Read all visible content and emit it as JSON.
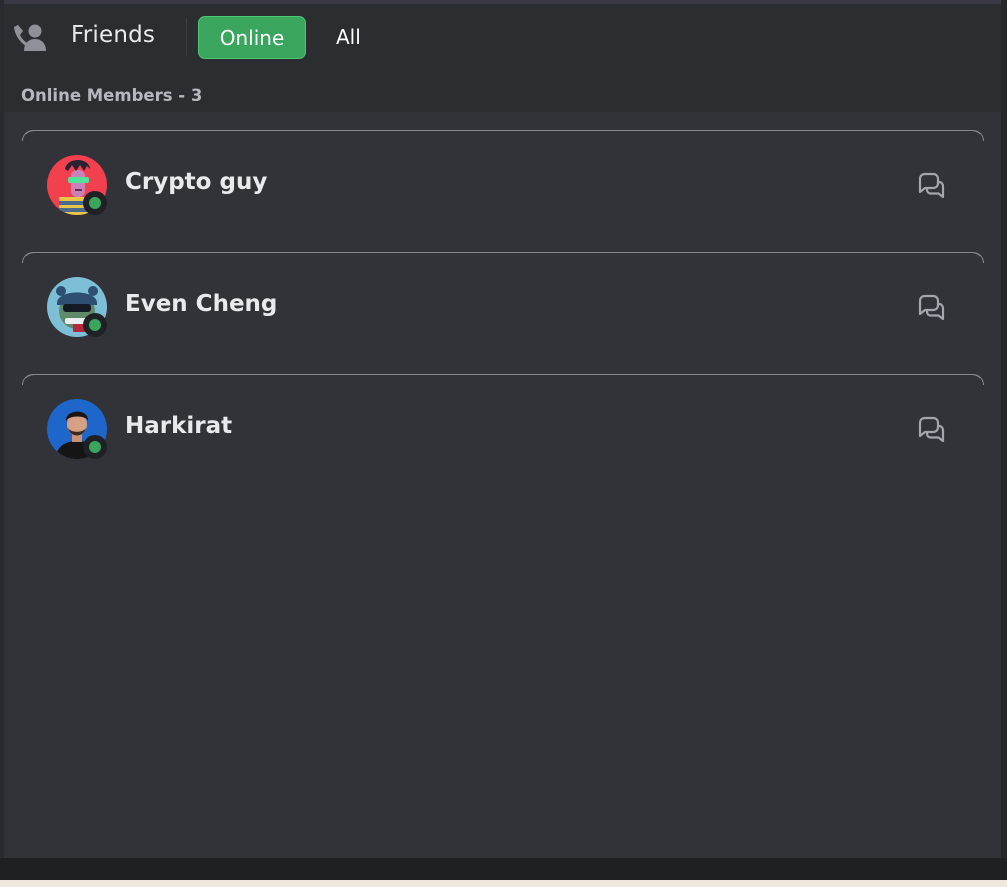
{
  "header": {
    "title": "Friends",
    "tabs": [
      {
        "label": "Online",
        "active": true
      },
      {
        "label": "All",
        "active": false
      }
    ]
  },
  "section": {
    "title": "Online Members - 3"
  },
  "members": [
    {
      "name": "Crypto guy",
      "status": "online",
      "avatar_bg": "#f2404e"
    },
    {
      "name": "Even Cheng",
      "status": "online",
      "avatar_bg": "#7dbfd6"
    },
    {
      "name": "Harkirat",
      "status": "online",
      "avatar_bg": "#1e66c9"
    }
  ],
  "colors": {
    "accent": "#3aa55d",
    "online": "#3ba55d",
    "panel": "#313338",
    "header": "#2b2d31"
  },
  "icons": {
    "friends": "friends-person-wave-icon",
    "message": "chat-bubbles-icon"
  }
}
